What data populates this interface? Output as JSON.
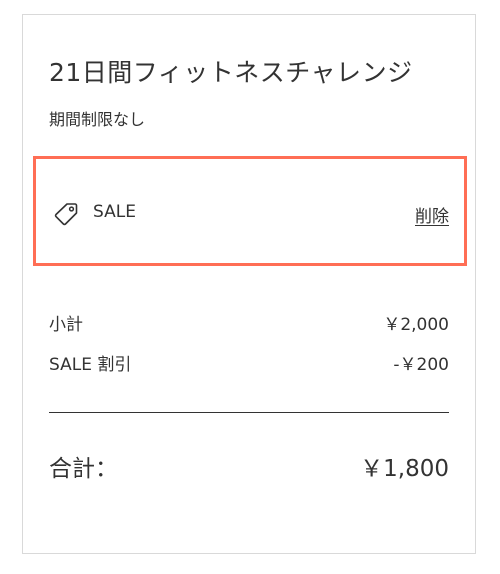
{
  "product": {
    "title": "21日間フィットネスチャレンジ",
    "subtitle": "期間制限なし"
  },
  "coupon": {
    "icon": "tag-icon",
    "name": "SALE",
    "remove_label": "削除",
    "highlight_color": "#ff6e55"
  },
  "summary": {
    "subtotal_label": "小計",
    "subtotal_value": "￥2,000",
    "discount_label": "SALE 割引",
    "discount_value": "-￥200",
    "total_label": "合計：",
    "total_value": "￥1,800"
  }
}
